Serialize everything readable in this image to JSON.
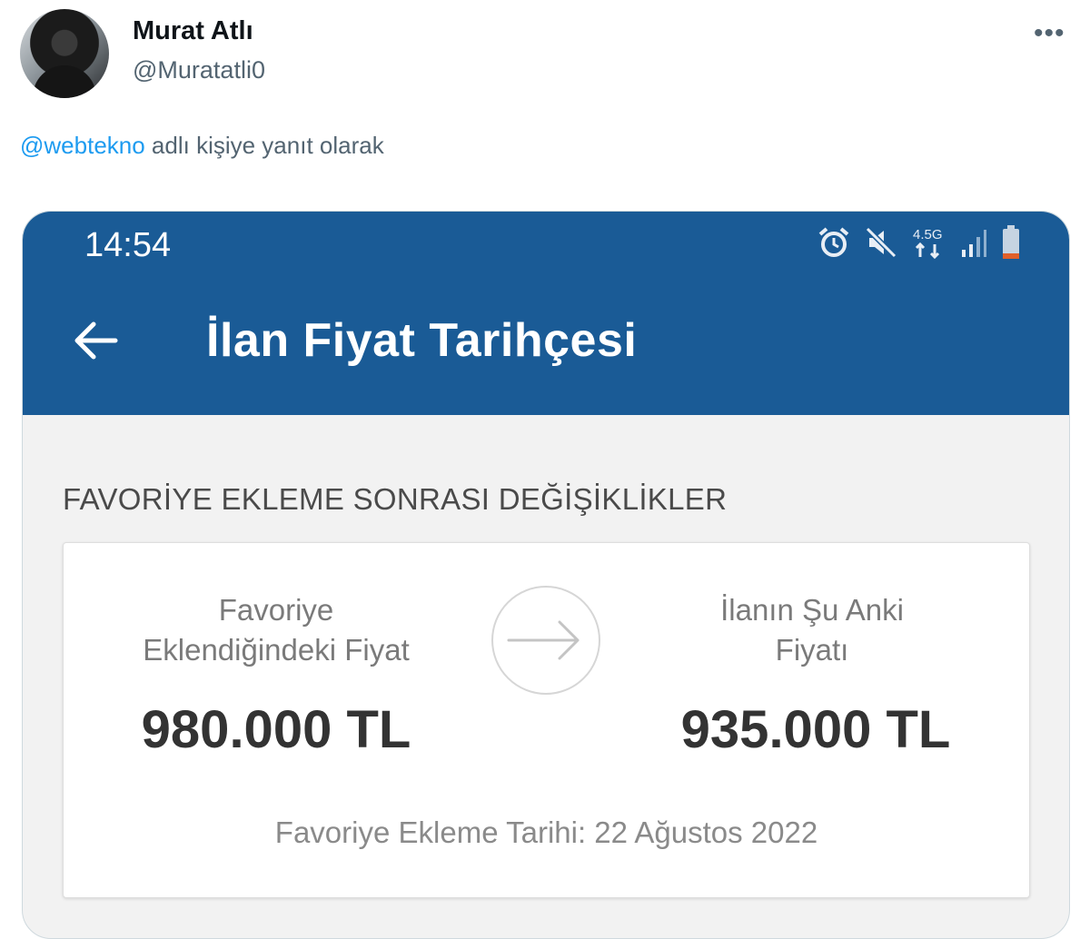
{
  "tweet": {
    "user_name": "Murat Atlı",
    "user_handle": "@Muratatli0",
    "more_icon": "more-dots-icon",
    "reply_mention": "@webtekno",
    "reply_suffix": " adlı kişiye yanıt olarak"
  },
  "phone": {
    "status_time": "14:54",
    "status_icons": [
      "alarm-icon",
      "mute-icon",
      "network-4.5g-icon",
      "signal-icon",
      "battery-icon"
    ],
    "network_label_top": "4.5G",
    "app_bar_title": "İlan Fiyat Tarihçesi",
    "section_label": "FAVORİYE EKLEME SONRASI DEĞİŞİKLİKLER",
    "card": {
      "left_label_line1": "Favoriye",
      "left_label_line2": "Eklendiğindeki Fiyat",
      "left_price": "980.000 TL",
      "right_label_line1": "İlanın Şu Anki",
      "right_label_line2": "Fiyatı",
      "right_price": "935.000 TL",
      "date_line": "Favoriye Ekleme Tarihi: 22 Ağustos 2022"
    }
  },
  "colors": {
    "app_bar": "#1a5b96",
    "mention": "#1d9bf0",
    "battery_low": "#e0602a"
  }
}
